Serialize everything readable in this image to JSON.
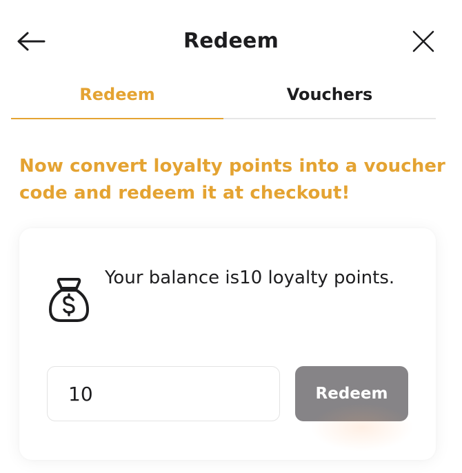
{
  "header": {
    "title": "Redeem",
    "back_icon": "arrow-left-icon",
    "close_icon": "close-icon"
  },
  "tabs": [
    {
      "label": "Redeem",
      "active": true
    },
    {
      "label": "Vouchers",
      "active": false
    }
  ],
  "info_text": "Now convert loyalty points into a voucher code and redeem it at checkout!",
  "card": {
    "icon": "money-bag-icon",
    "balance_prefix": "Your balance is",
    "balance_value": "10",
    "balance_suffix": " loyalty points.",
    "quantity_value": "10",
    "increment_label": "+",
    "decrement_label": "-",
    "redeem_label": "Redeem"
  },
  "colors": {
    "accent": "#e4a332",
    "button_disabled": "#868487",
    "text": "#1d1d1f"
  }
}
